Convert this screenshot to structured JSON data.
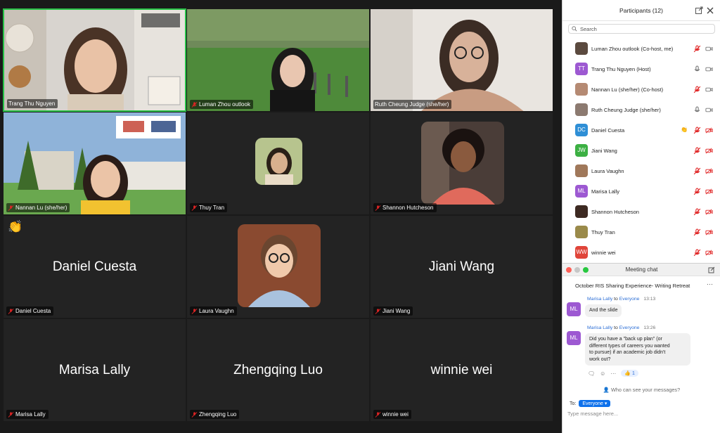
{
  "participants_panel": {
    "title": "Participants (12)",
    "search_placeholder": "Search",
    "list": [
      {
        "name": "Luman Zhou outlook (Co-host, me)",
        "initials": "",
        "color": "#5b4a3f"
      },
      {
        "name": "Trang Thu Nguyen (Host)",
        "initials": "TT",
        "color": "#9d59d2"
      },
      {
        "name": "Nannan Lu (she/her) (Co-host)",
        "initials": "",
        "color": "#b58a73"
      },
      {
        "name": "Ruth Cheung Judge (she/her)",
        "initials": "",
        "color": "#8c7a70"
      },
      {
        "name": "Daniel Cuesta",
        "initials": "DC",
        "color": "#2f8fd6"
      },
      {
        "name": "Jiani Wang",
        "initials": "JW",
        "color": "#3cb043"
      },
      {
        "name": "Laura Vaughn",
        "initials": "",
        "color": "#a0785a"
      },
      {
        "name": "Marisa Lally",
        "initials": "ML",
        "color": "#9d59d2"
      },
      {
        "name": "Shannon Hutcheson",
        "initials": "",
        "color": "#3d2a22"
      },
      {
        "name": "Thuy Tran",
        "initials": "",
        "color": "#9a8a4a"
      },
      {
        "name": "winnie wei",
        "initials": "WW",
        "color": "#e0453a"
      }
    ]
  },
  "video_tiles": [
    {
      "label": "Trang Thu Nguyen"
    },
    {
      "label": "Luman Zhou outlook"
    },
    {
      "label": "Ruth Cheung Judge (she/her)"
    },
    {
      "label": "Nannan Lu (she/her)"
    },
    {
      "label": "Thuy Tran"
    },
    {
      "label": "Shannon Hutcheson"
    },
    {
      "label": "Daniel Cuesta",
      "big": "Daniel Cuesta"
    },
    {
      "label": "Laura Vaughn"
    },
    {
      "label": "Jiani Wang",
      "big": "Jiani Wang"
    },
    {
      "label": "Marisa Lally",
      "big": "Marisa Lally"
    },
    {
      "label": "Zhengqing Luo",
      "big": "Zhengqing Luo"
    },
    {
      "label": "winnie wei",
      "big": "winnie wei"
    }
  ],
  "chat": {
    "title": "Meeting chat",
    "subject": "October RIS Sharing Experience- Writing Retreat",
    "messages": [
      {
        "initials": "ML",
        "sender": "Marisa Lally",
        "to_word": "to",
        "recipient": "Everyone",
        "time": "13:13",
        "text": "And the slide"
      },
      {
        "initials": "ML",
        "sender": "Marisa Lally",
        "to_word": "to",
        "recipient": "Everyone",
        "time": "13:26",
        "lines": [
          "Did you have a \"back up plan\" (or",
          "different types of careers you wanted",
          "to pursue) if an academic job didn't",
          "work out?"
        ]
      }
    ],
    "reaction": "👍 1",
    "who_can_see": "Who can see your messages?",
    "to_label": "To:",
    "to_value": "Everyone",
    "input_placeholder": "Type message here..."
  },
  "colors": {
    "active_speaker": "#27c146",
    "accent": "#0e71eb",
    "chat_avatar": "#9d59d2"
  }
}
